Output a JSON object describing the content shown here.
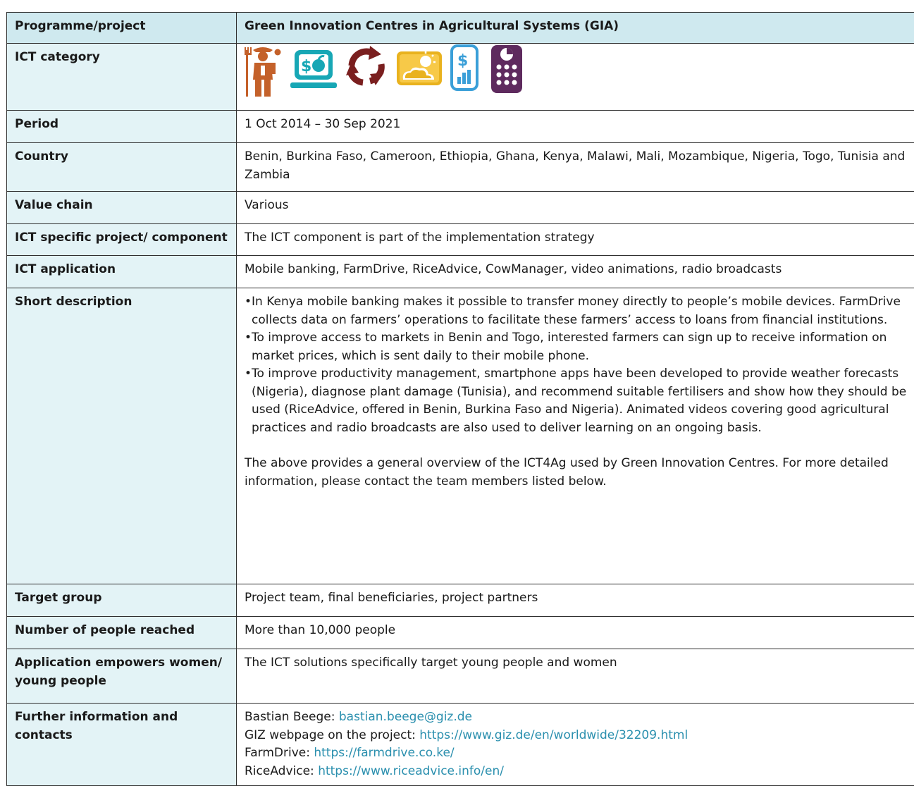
{
  "header": {
    "label": "Programme/project",
    "value": "Green Innovation Centres in Agricultural Systems (GIA)"
  },
  "ict_category": {
    "label": "ICT category",
    "icons": [
      "farmer-icon",
      "market-price-computer-icon",
      "recycle-arrows-icon",
      "weather-icon",
      "mobile-finance-icon",
      "calculator-phone-icon"
    ],
    "colors": {
      "farmer": "#c4612a",
      "computer": "#17a7b5",
      "recycle": "#7a1f1f",
      "weather": "#e9b21e",
      "finance": "#3a9fd8",
      "phone": "#5e2a5e"
    }
  },
  "period": {
    "label": "Period",
    "value": "1 Oct 2014 – 30 Sep 2021"
  },
  "country": {
    "label": "Country",
    "value": "Benin, Burkina Faso, Cameroon, Ethiopia, Ghana, Kenya, Malawi, Mali, Mozambique, Nigeria, Togo, Tunisia and Zambia"
  },
  "value_chain": {
    "label": "Value chain",
    "value": "Various"
  },
  "ict_component": {
    "label": "ICT specific project/ component",
    "value": "The ICT component is part of the implementation strategy"
  },
  "ict_application": {
    "label": "ICT application",
    "value": "Mobile banking, FarmDrive, RiceAdvice, CowManager, video animations, radio broadcasts"
  },
  "description": {
    "label": "Short description",
    "bullets": [
      "In Kenya mobile banking makes it possible to transfer money directly to people’s mobile devices. FarmDrive collects data on farmers’ operations to facilitate these farmers’ access to loans from financial institutions.",
      "To improve access to markets in Benin and Togo, interested farmers can sign up to receive information on market prices, which is sent daily to their mobile phone.",
      "To improve productivity management, smartphone apps have been developed to provide weather forecasts (Nigeria), diagnose plant damage (Tunisia), and recommend suitable fertilisers and show how they should be used (RiceAdvice, offered in Benin, Burkina Faso and Nigeria). Animated videos covering good agricultural practices and radio broadcasts are also used to deliver learning on an ongoing basis."
    ],
    "bullet_mark": "•",
    "paragraph": "The above provides a general overview of the ICT4Ag used by Green Innovation Centres. For more detailed information, please contact the team members listed below."
  },
  "target_group": {
    "label": "Target group",
    "value": "Project team, final beneficiaries, project partners"
  },
  "people_reached": {
    "label": "Number of people reached",
    "value": "More than 10,000 people"
  },
  "empowers": {
    "label": "Application empowers women/ young people",
    "value": "The ICT solutions specifically target young people and women"
  },
  "contacts": {
    "label": "Further information and contacts",
    "items": [
      {
        "prefix": "Bastian Beege: ",
        "link": "bastian.beege@giz.de"
      },
      {
        "prefix": "GIZ webpage on the project: ",
        "link": "https://www.giz.de/en/worldwide/32209.html"
      },
      {
        "prefix": "FarmDrive: ",
        "link": "https://farmdrive.co.ke/"
      },
      {
        "prefix": "RiceAdvice: ",
        "link": "https://www.riceadvice.info/en/"
      }
    ]
  }
}
